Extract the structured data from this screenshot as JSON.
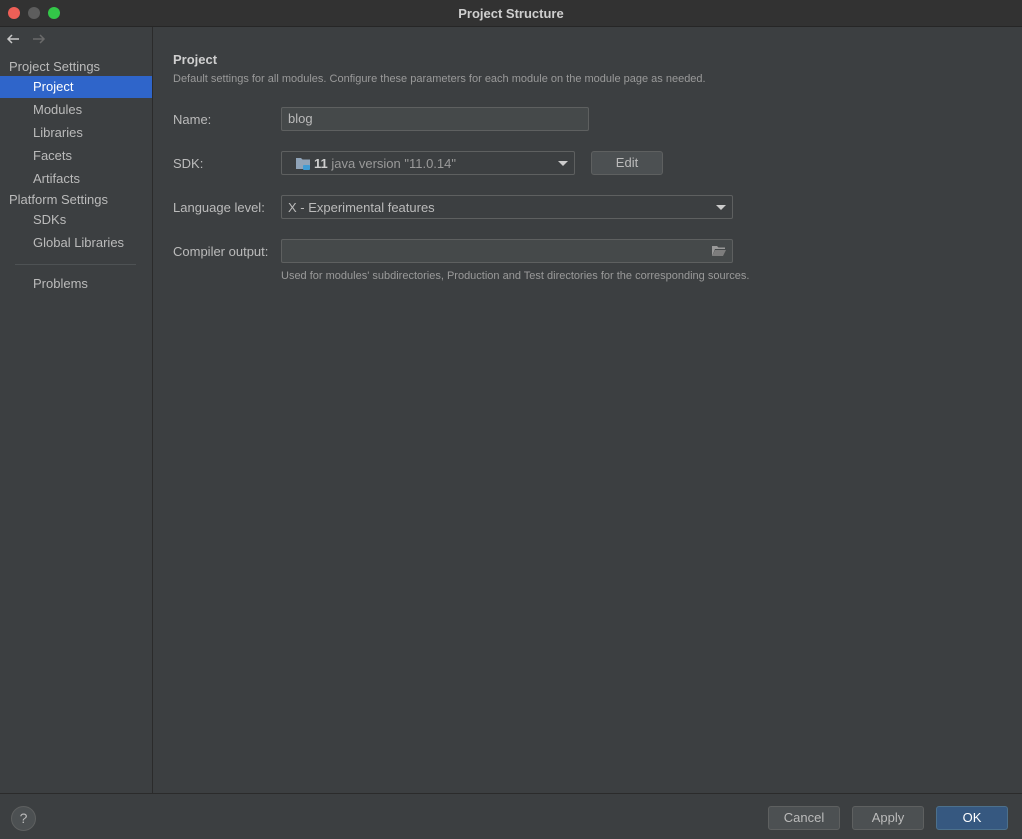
{
  "window": {
    "title": "Project Structure"
  },
  "sidebar": {
    "project_settings_label": "Project Settings",
    "project_items": [
      {
        "label": "Project",
        "active": true
      },
      {
        "label": "Modules"
      },
      {
        "label": "Libraries"
      },
      {
        "label": "Facets"
      },
      {
        "label": "Artifacts"
      }
    ],
    "platform_settings_label": "Platform Settings",
    "platform_items": [
      {
        "label": "SDKs"
      },
      {
        "label": "Global Libraries"
      }
    ],
    "problems_label": "Problems"
  },
  "main": {
    "heading": "Project",
    "description": "Default settings for all modules. Configure these parameters for each module on the module page as needed.",
    "name_label": "Name:",
    "name_value": "blog",
    "sdk_label": "SDK:",
    "sdk_number": "11",
    "sdk_version": "java version \"11.0.14\"",
    "edit_label": "Edit",
    "language_level_label": "Language level:",
    "language_level_value": "X - Experimental features",
    "compiler_output_label": "Compiler output:",
    "compiler_output_value": "",
    "compiler_output_hint": "Used for modules' subdirectories, Production and Test directories for the corresponding sources."
  },
  "footer": {
    "help_label": "?",
    "cancel_label": "Cancel",
    "apply_label": "Apply",
    "ok_label": "OK"
  },
  "colors": {
    "accent_selection": "#2f65ca",
    "primary_button": "#365880",
    "background": "#3c3f41"
  }
}
